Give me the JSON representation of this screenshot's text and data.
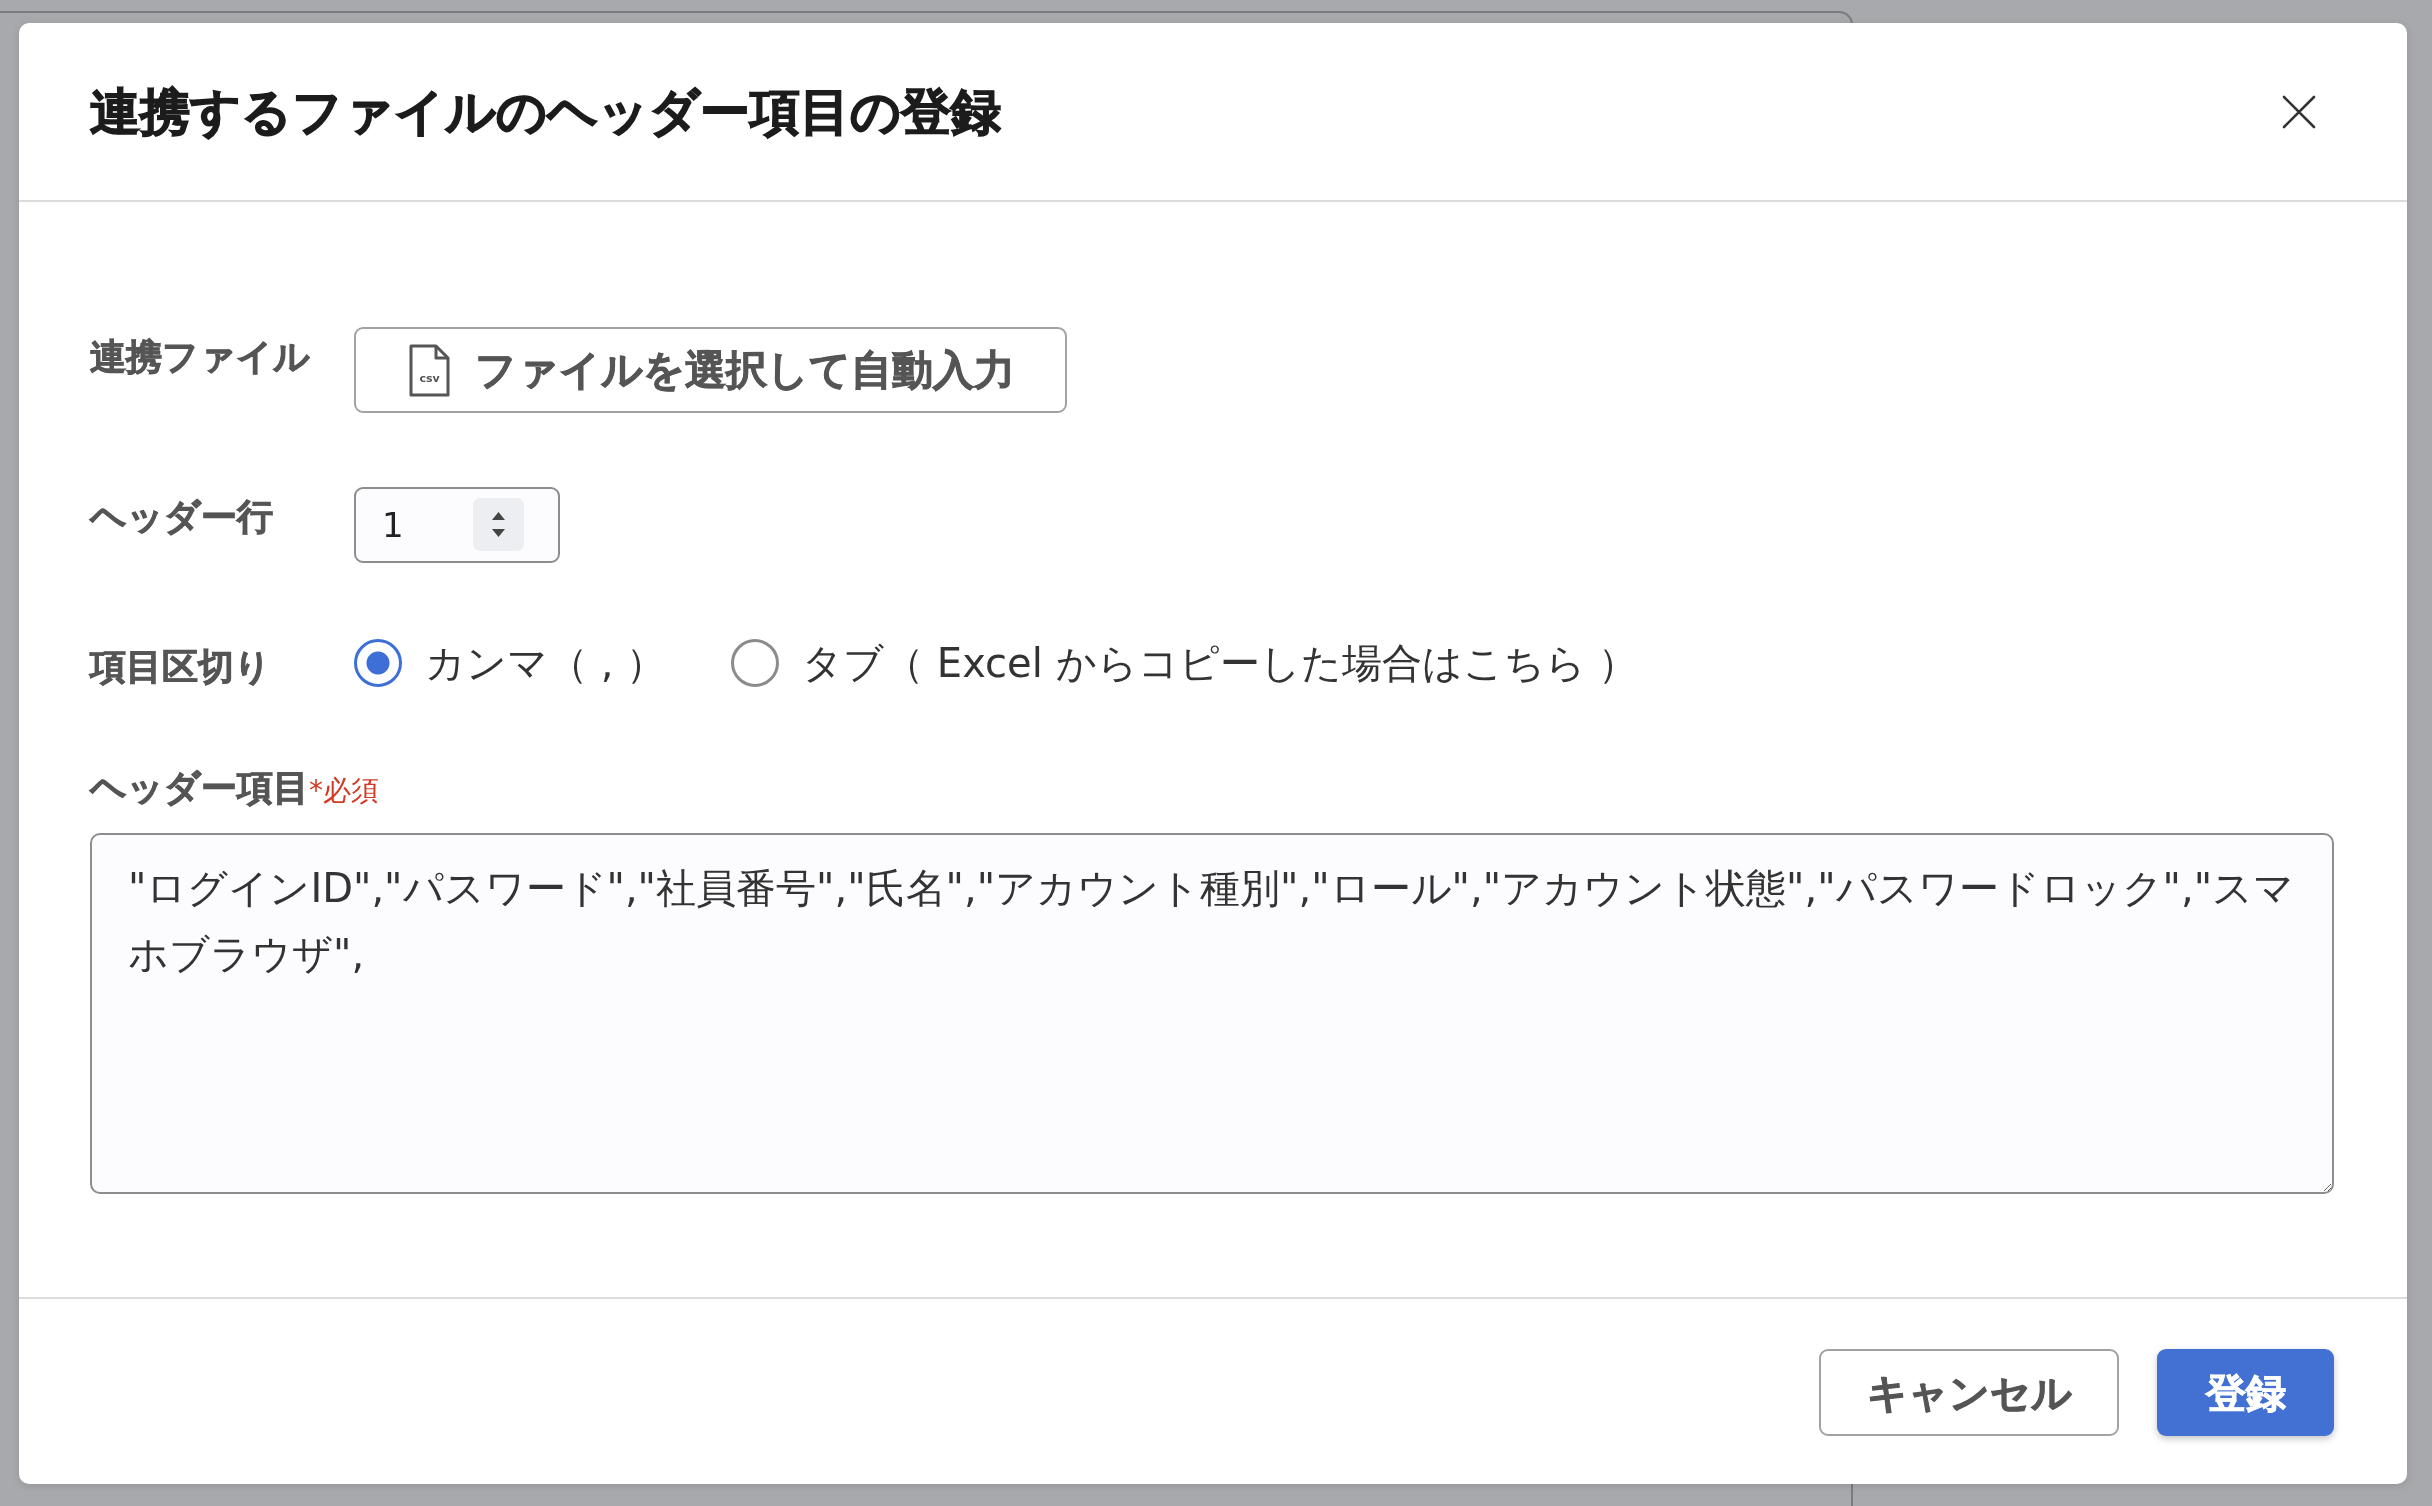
{
  "dialog": {
    "title": "連携するファイルのヘッダー項目の登録",
    "fields": [
      {
        "kind": "file",
        "label": "連携ファイル",
        "icon_label": "csv",
        "button": "ファイルを選択して自動入力"
      },
      {
        "kind": "number",
        "label": "ヘッダー行",
        "value": "1"
      },
      {
        "kind": "radio",
        "label": "項目区切り",
        "options": [
          {
            "label": "カンマ（ , ）",
            "selected": true
          },
          {
            "label": "タブ（ Excel からコピーした場合はこちら ）",
            "selected": false
          }
        ]
      },
      {
        "kind": "textarea",
        "label": "ヘッダー項目",
        "required_mark": "*必須",
        "value": "\"ログインID\",\"パスワード\",\"社員番号\",\"氏名\",\"アカウント種別\",\"ロール\",\"アカウント状態\",\"パスワードロック\",\"スマホブラウザ\","
      }
    ],
    "footer_buttons": [
      {
        "kind": "cancel",
        "label": "キャンセル"
      },
      {
        "kind": "submit",
        "label": "登録"
      }
    ]
  }
}
